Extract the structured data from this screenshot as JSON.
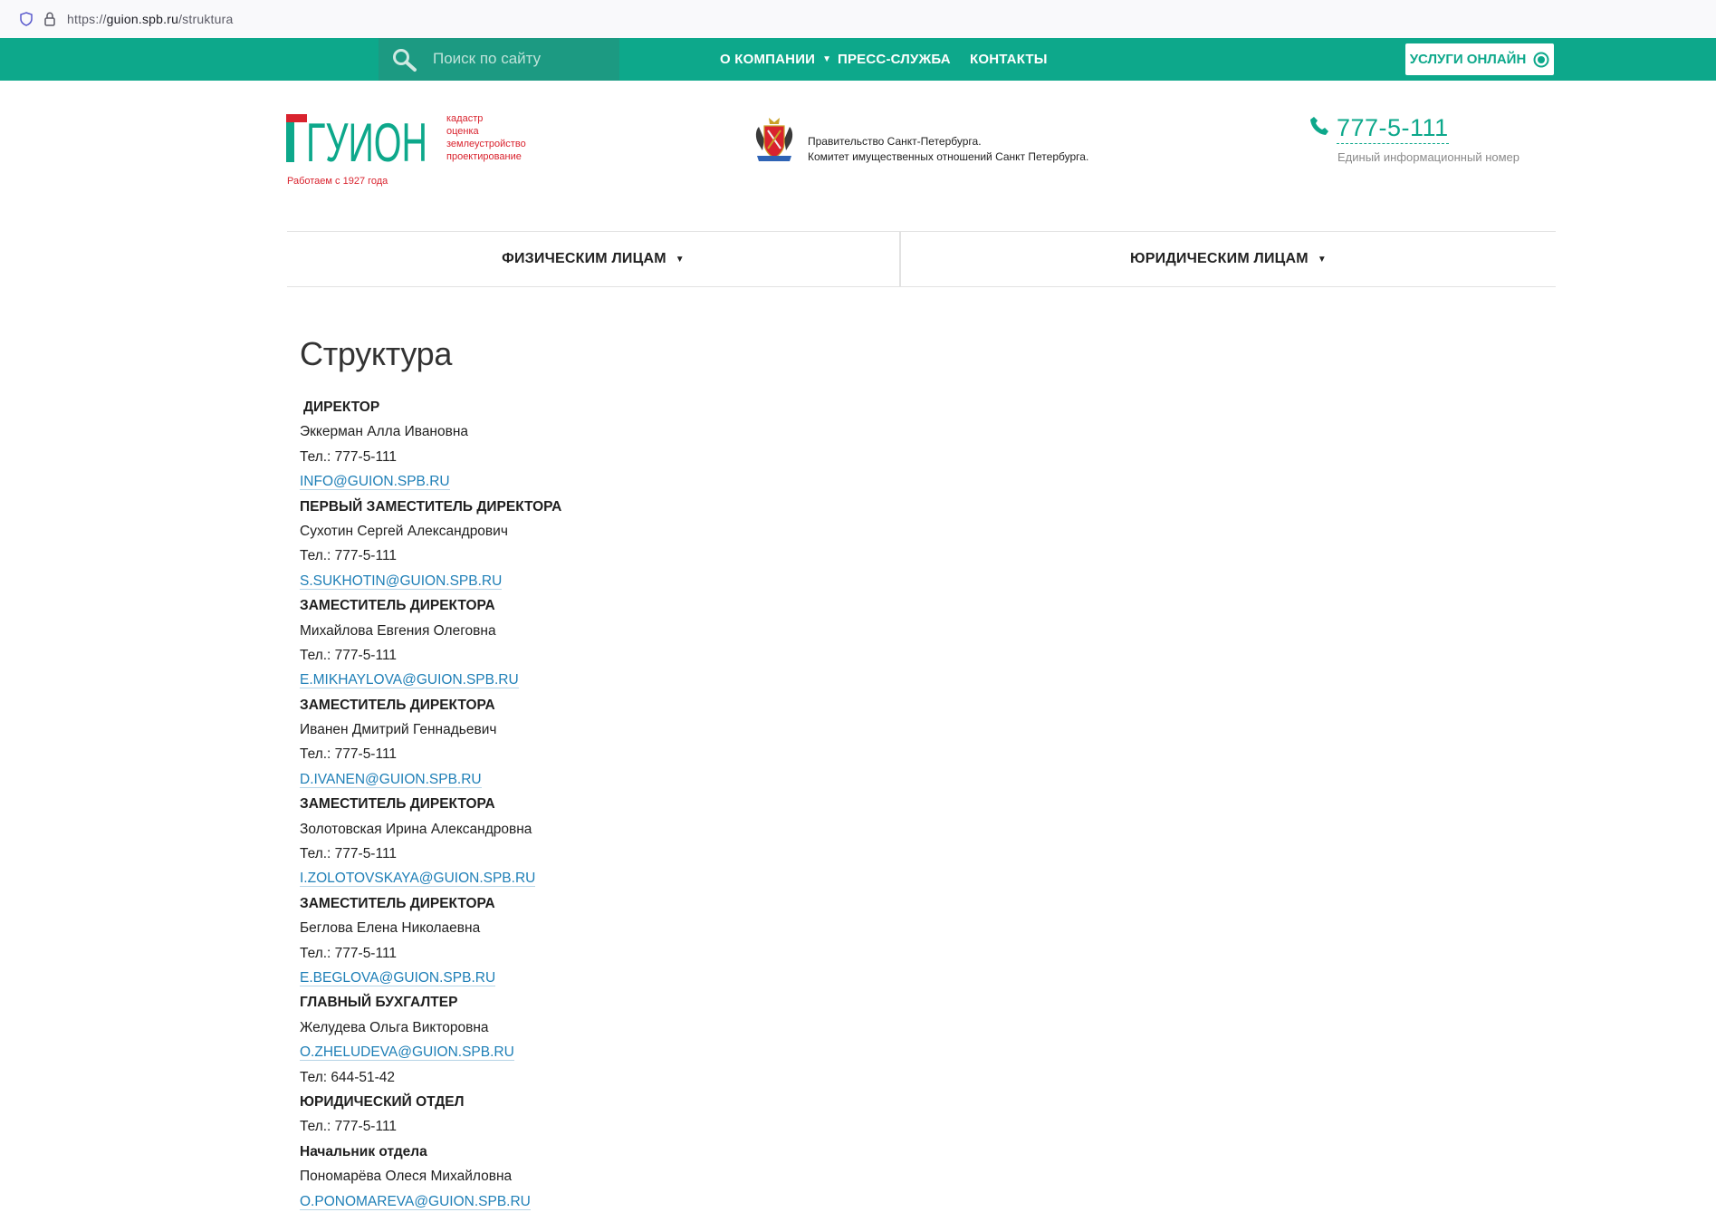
{
  "browser": {
    "url_prefix": "https://",
    "url_host": "guion.spb.ru",
    "url_path": "/struktura"
  },
  "topbar": {
    "search_placeholder": "Поиск по сайту",
    "nav": [
      {
        "label": "О КОМПАНИИ",
        "has_dropdown": true
      },
      {
        "label": "ПРЕСС-СЛУЖБА"
      },
      {
        "label": "КОНТАКТЫ"
      }
    ],
    "online_button": "УСЛУГИ ОНЛАЙН"
  },
  "header": {
    "logo_text": "ГУИОН",
    "logo_tags": [
      "кадастр",
      "оценка",
      "землеустройство",
      "проектирование"
    ],
    "since": "Работаем с 1927 года",
    "gov_line1": "Правительство Санкт-Петербурга.",
    "gov_line2": "Комитет имущественных отношений Санкт Петербурга.",
    "phone": "777-5-111",
    "phone_caption": "Единый информационный номер"
  },
  "persona_nav": [
    {
      "label": "ФИЗИЧЕСКИМ ЛИЦАМ"
    },
    {
      "label": "ЮРИДИЧЕСКИМ ЛИЦАМ"
    }
  ],
  "page": {
    "title": "Структура",
    "lines": [
      {
        "type": "heading",
        "text": "ДИРЕКТОР"
      },
      {
        "type": "text",
        "text": "Эккерман Алла Ивановна"
      },
      {
        "type": "text",
        "text": "Тел.: 777-5-111"
      },
      {
        "type": "email",
        "text": "INFO@GUION.SPB.RU"
      },
      {
        "type": "heading",
        "text": "ПЕРВЫЙ ЗАМЕСТИТЕЛЬ ДИРЕКТОРА"
      },
      {
        "type": "text",
        "text": "Сухотин Сергей Александрович"
      },
      {
        "type": "text",
        "text": "Тел.: 777-5-111"
      },
      {
        "type": "email",
        "text": "S.SUKHOTIN@GUION.SPB.RU"
      },
      {
        "type": "heading",
        "text": "ЗАМЕСТИТЕЛЬ  ДИРЕКТОРА"
      },
      {
        "type": "text",
        "text": "Михайлова Евгения Олеговна"
      },
      {
        "type": "text",
        "text": "Тел.: 777-5-111"
      },
      {
        "type": "email",
        "text": "E.MIKHAYLOVA@GUION.SPB.RU"
      },
      {
        "type": "heading",
        "text": "ЗАМЕСТИТЕЛЬ  ДИРЕКТОРА"
      },
      {
        "type": "text",
        "text": "Иванен Дмитрий Геннадьевич"
      },
      {
        "type": "text",
        "text": "Тел.: 777-5-111"
      },
      {
        "type": "email",
        "text": "D.IVANEN@GUION.SPB.RU"
      },
      {
        "type": "heading",
        "text": "ЗАМЕСТИТЕЛЬ ДИРЕКТОРА"
      },
      {
        "type": "text",
        "text": "Золотовская Ирина Александровна"
      },
      {
        "type": "text",
        "text": "Тел.: 777-5-111"
      },
      {
        "type": "email",
        "text": "I.ZOLOTOVSKAYA@GUION.SPB.RU"
      },
      {
        "type": "heading",
        "text": "ЗАМЕСТИТЕЛЬ ДИРЕКТОРА"
      },
      {
        "type": "text",
        "text": "Беглова Елена Николаевна"
      },
      {
        "type": "text",
        "text": "Тел.: 777-5-111"
      },
      {
        "type": "email",
        "text": "E.BEGLOVA@GUION.SPB.RU"
      },
      {
        "type": "heading",
        "text": "ГЛАВНЫЙ БУХГАЛТЕР"
      },
      {
        "type": "text",
        "text": "Желудева Ольга Викторовна"
      },
      {
        "type": "email",
        "text": "O.ZHELUDEVA@GUION.SPB.RU"
      },
      {
        "type": "text",
        "text": "Тел: 644-51-42"
      },
      {
        "type": "heading",
        "text": "ЮРИДИЧЕСКИЙ ОТДЕЛ"
      },
      {
        "type": "text",
        "text": "Тел.: 777-5-111"
      },
      {
        "type": "subheading",
        "text": "Начальник отдела"
      },
      {
        "type": "text",
        "text": "Пономарёва Олеся Михайловна"
      },
      {
        "type": "email",
        "text": "O.PONOMAREVA@GUION.SPB.RU"
      }
    ]
  },
  "colors": {
    "brand_green": "#0da88b",
    "brand_red": "#d9232e",
    "link_blue": "#1e7fb7"
  },
  "icons": [
    "shield-icon",
    "lock-icon",
    "search-icon",
    "online-ring-icon",
    "phone-icon",
    "coat-of-arms-icon"
  ]
}
